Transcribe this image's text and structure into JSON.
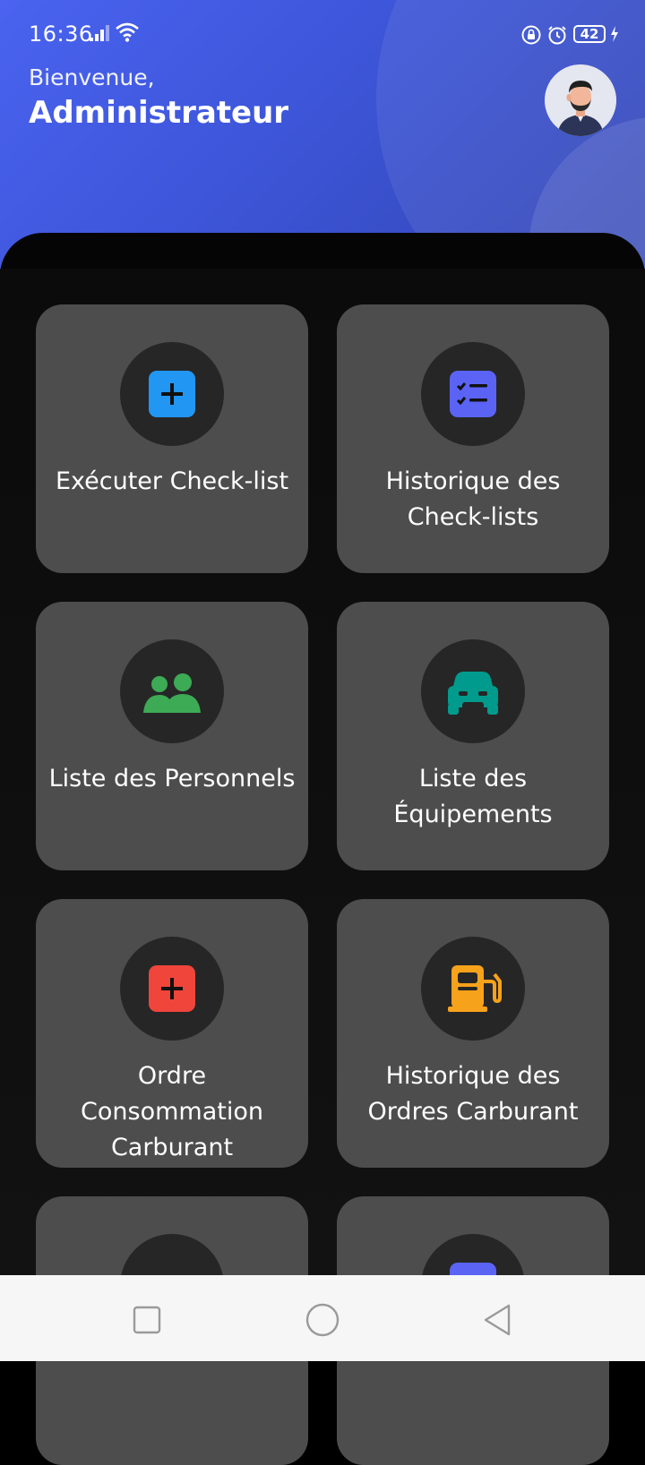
{
  "status_bar": {
    "time": "16:36",
    "battery": "42"
  },
  "header": {
    "greeting": "Bienvenue,",
    "user_role": "Administrateur"
  },
  "menu": {
    "cards": [
      {
        "label": "Exécuter Check-list",
        "icon": "add-box-icon",
        "color": "#2196F3"
      },
      {
        "label": "Historique des Check-lists",
        "icon": "checklist-icon",
        "color": "#5B63F5"
      },
      {
        "label": "Liste des Personnels",
        "icon": "people-icon",
        "color": "#3DAA55"
      },
      {
        "label": "Liste des Équipements",
        "icon": "vehicle-icon",
        "color": "#009B8D"
      },
      {
        "label": "Ordre Consommation Carburant",
        "icon": "add-box-icon",
        "color": "#F0453B"
      },
      {
        "label": "Historique des Ordres Carburant",
        "icon": "fuel-pump-icon",
        "color": "#F7A21B"
      }
    ]
  },
  "colors": {
    "header_gradient_start": "#4a63f0",
    "header_gradient_end": "#3246b4",
    "card_bg": "#4d4d4d",
    "icon_circle_bg": "#262626"
  }
}
